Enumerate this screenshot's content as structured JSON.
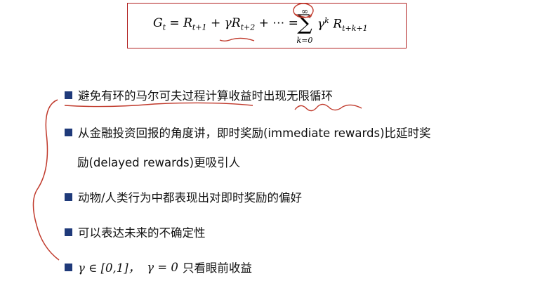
{
  "formula": {
    "lhs": "G",
    "lhs_sub": "t",
    "r1": "R",
    "r1_sub": "t+1",
    "plus1": "+",
    "gamma1": "γ",
    "r2": "R",
    "r2_sub": "t+2",
    "plus_dots": "+ ⋯ =",
    "sum_upper": "∞",
    "sum_symbol": "∑",
    "sum_lower": "k=0",
    "gamma2": "γ",
    "gamma2_sup": "k",
    "r3": "R",
    "r3_sub": "t+k+1",
    "equals": "="
  },
  "bullets": [
    {
      "text": "避免有环的马尔可夫过程计算收益时出现无限循环"
    },
    {
      "text": "从金融投资回报的角度讲，即时奖励(immediate rewards)比延时奖"
    },
    {
      "text": "励(delayed rewards)更吸引人"
    },
    {
      "text": "动物/人类行为中都表现出对即时奖励的偏好"
    },
    {
      "text": "可以表达未来的不确定性"
    }
  ],
  "last_bullet": {
    "gamma_a": "γ ∈ [0,1]，",
    "gamma_b": "γ = 0",
    "text": "只看眼前收益"
  },
  "colors": {
    "box_border": "#b22222",
    "bullet_square": "#1f3a7a",
    "annotation_ink": "#c0392b"
  }
}
